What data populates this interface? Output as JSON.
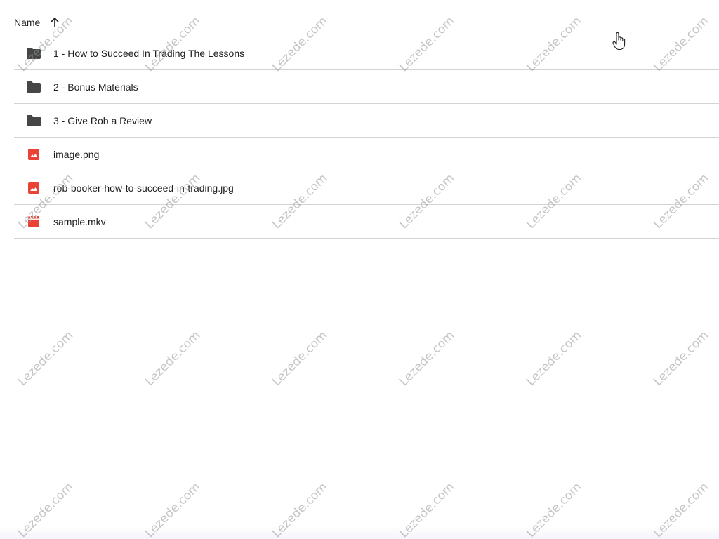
{
  "header": {
    "name_label": "Name",
    "sort_direction": "ascending"
  },
  "files": [
    {
      "name": "1 - How to Succeed In Trading The Lessons",
      "type": "folder",
      "icon": "folder-icon"
    },
    {
      "name": "2 - Bonus Materials",
      "type": "folder",
      "icon": "folder-icon"
    },
    {
      "name": "3 - Give Rob a Review",
      "type": "folder",
      "icon": "folder-icon"
    },
    {
      "name": "image.png",
      "type": "image",
      "icon": "image-file-icon"
    },
    {
      "name": "rob-booker-how-to-succeed-in-trading.jpg",
      "type": "image",
      "icon": "image-file-icon"
    },
    {
      "name": "sample.mkv",
      "type": "video",
      "icon": "video-file-icon"
    }
  ],
  "watermark": {
    "text": "Lezede.com"
  },
  "colors": {
    "folder": "#444746",
    "image": "#ea4335",
    "video": "#ea4335",
    "divider": "#d3d3d3",
    "text": "#1f1f1f"
  }
}
